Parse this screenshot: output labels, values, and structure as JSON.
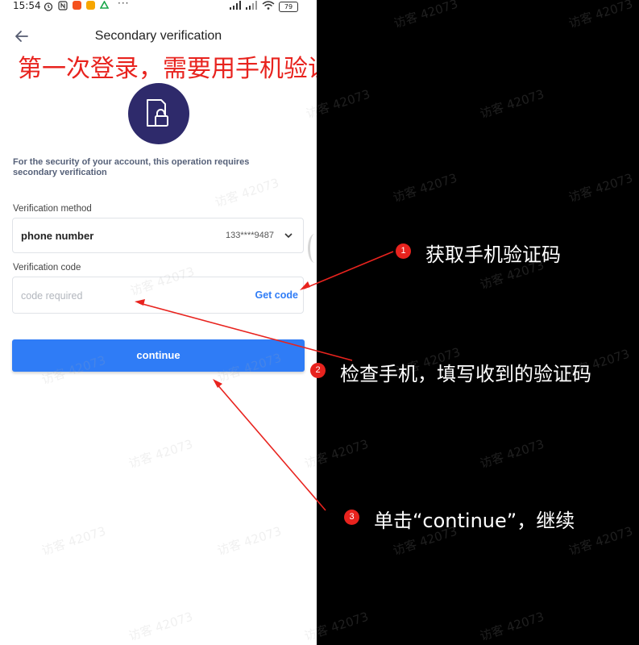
{
  "status_bar": {
    "time": "15:54",
    "more_dots": "···",
    "battery": "79"
  },
  "header": {
    "title": "Secondary verification"
  },
  "banner": "第一次登录，需要用手机验证码",
  "security_notice": "For the security of your account, this operation requires secondary verification",
  "verification_method": {
    "label": "Verification method",
    "value": "phone number",
    "phone": "133****9487"
  },
  "verification_code": {
    "label": "Verification code",
    "placeholder": "code required",
    "value": "",
    "get_code": "Get code"
  },
  "continue_label": "continue",
  "watermark": "访客 42073",
  "callouts": [
    {
      "number": "1",
      "text": "获取手机验证码"
    },
    {
      "number": "2",
      "text": "检查手机，填写收到的验证码"
    },
    {
      "number": "3",
      "text": "单击“continue”，继续"
    }
  ],
  "colors": {
    "accent": "#2f7cf6",
    "annotation_red": "#e8231e",
    "lock_circle": "#2e2a6b",
    "callout_background": "#000000"
  },
  "icons": [
    "back-arrow-icon",
    "lock-icon",
    "chevron-down-icon",
    "wifi-icon",
    "signal-icon",
    "alarm-icon",
    "nfc-icon"
  ]
}
